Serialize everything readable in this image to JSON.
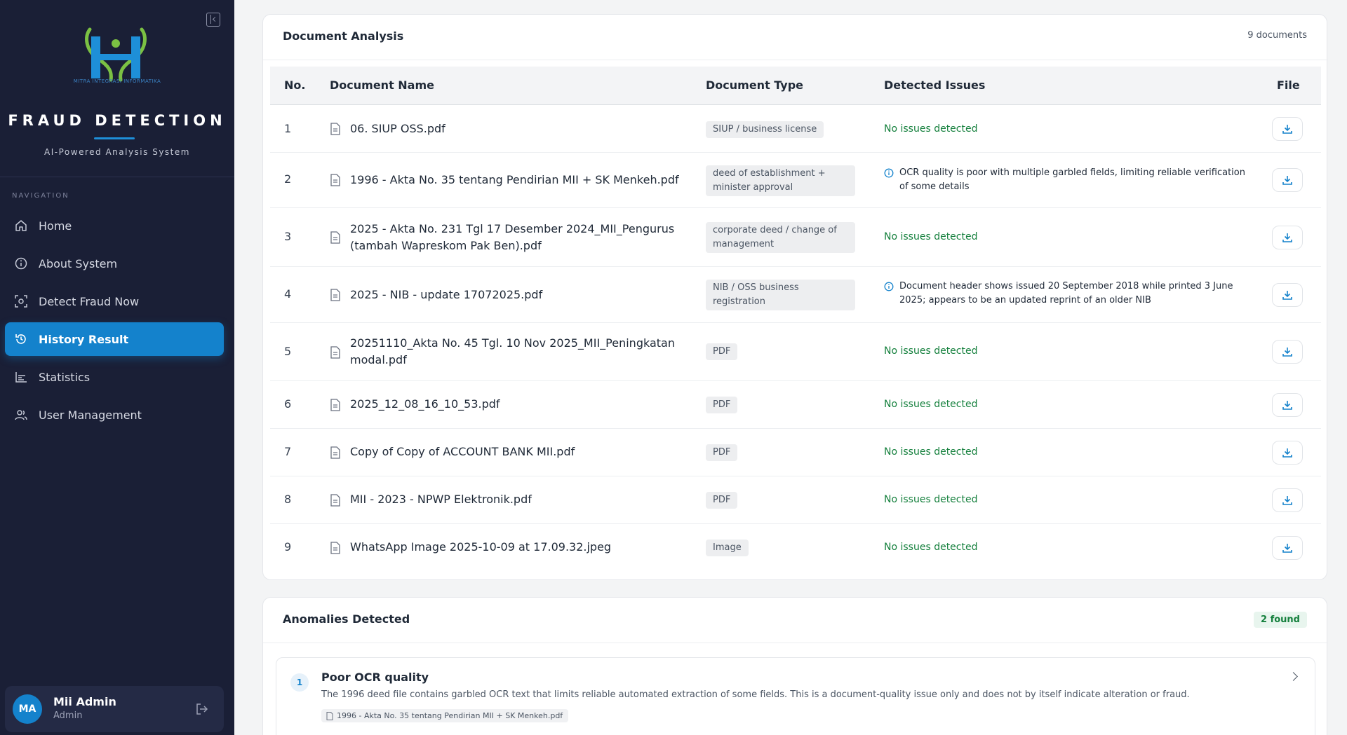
{
  "sidebar": {
    "logo_caption": "MITRA INTEGRASI INFORMATIKA",
    "brand_title": "FRAUD DETECTION",
    "brand_subtitle": "AI-Powered Analysis System",
    "nav_heading": "NAVIGATION",
    "items": [
      {
        "label": "Home",
        "icon": "home-icon"
      },
      {
        "label": "About System",
        "icon": "info-icon"
      },
      {
        "label": "Detect Fraud Now",
        "icon": "scan-icon"
      },
      {
        "label": "History Result",
        "icon": "history-icon",
        "active": true
      },
      {
        "label": "Statistics",
        "icon": "chart-icon"
      },
      {
        "label": "User Management",
        "icon": "users-icon"
      }
    ],
    "user": {
      "initials": "MA",
      "name": "Mii Admin",
      "role": "Admin"
    }
  },
  "documents": {
    "title": "Document Analysis",
    "count": "9 documents",
    "headers": {
      "no": "No.",
      "name": "Document Name",
      "type": "Document Type",
      "issues": "Detected Issues",
      "file": "File"
    },
    "rows": [
      {
        "no": "1",
        "name": "06. SIUP OSS.pdf",
        "type": "SIUP / business license",
        "issue": "No issues detected",
        "ok": true
      },
      {
        "no": "2",
        "name": "1996 - Akta No. 35 tentang Pendirian MII + SK Menkeh.pdf",
        "type": "deed of establishment + minister approval",
        "issue": "OCR quality is poor with multiple garbled fields, limiting reliable verification of some details",
        "ok": false
      },
      {
        "no": "3",
        "name": "2025 - Akta No. 231 Tgl 17 Desember 2024_MII_Pengurus (tambah Wapreskom Pak Ben).pdf",
        "type": "corporate deed / change of management",
        "issue": "No issues detected",
        "ok": true
      },
      {
        "no": "4",
        "name": "2025 - NIB - update 17072025.pdf",
        "type": "NIB / OSS business registration",
        "issue": "Document header shows issued 20 September 2018 while printed 3 June 2025; appears to be an updated reprint of an older NIB",
        "ok": false
      },
      {
        "no": "5",
        "name": "20251110_Akta No. 45 Tgl. 10 Nov 2025_MII_Peningkatan modal.pdf",
        "type": "PDF",
        "issue": "No issues detected",
        "ok": true
      },
      {
        "no": "6",
        "name": "2025_12_08_16_10_53.pdf",
        "type": "PDF",
        "issue": "No issues detected",
        "ok": true
      },
      {
        "no": "7",
        "name": "Copy of Copy of ACCOUNT BANK MII.pdf",
        "type": "PDF",
        "issue": "No issues detected",
        "ok": true
      },
      {
        "no": "8",
        "name": "MII - 2023 - NPWP Elektronik.pdf",
        "type": "PDF",
        "issue": "No issues detected",
        "ok": true
      },
      {
        "no": "9",
        "name": "WhatsApp Image 2025-10-09 at 17.09.32.jpeg",
        "type": "Image",
        "issue": "No issues detected",
        "ok": true
      }
    ]
  },
  "anomalies": {
    "title": "Anomalies Detected",
    "found": "2 found",
    "items": [
      {
        "number": "1",
        "title": "Poor OCR quality",
        "description": "The 1996 deed file contains garbled OCR text that limits reliable automated extraction of some fields. This is a document-quality issue only and does not by itself indicate alteration or fraud.",
        "file": "1996 - Akta No. 35 tentang Pendirian MII + SK Menkeh.pdf"
      }
    ]
  },
  "colors": {
    "sidebar_bg": "#1a1f36",
    "accent": "#1482cc",
    "ok_green": "#15803d"
  }
}
